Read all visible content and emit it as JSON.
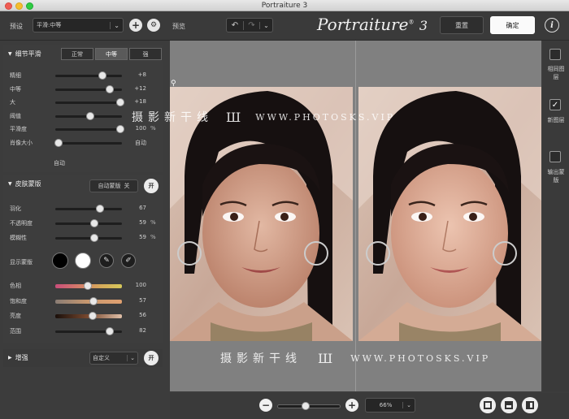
{
  "window": {
    "title": "Portraiture 3"
  },
  "toolbar": {
    "preset_label": "预设",
    "preset_value": "平滑:中等",
    "preview_label": "预览",
    "logo": "Portraiture",
    "logo_version": "3",
    "reset_label": "重置",
    "ok_label": "确定",
    "info_symbol": "i"
  },
  "detail": {
    "header": "细节平滑",
    "modes": [
      "正常",
      "中等",
      "强"
    ],
    "active_mode": "中等",
    "sliders": [
      {
        "label": "精细",
        "value": "+8",
        "unit": "",
        "pos": 0.71
      },
      {
        "label": "中等",
        "value": "+12",
        "unit": "",
        "pos": 0.82
      },
      {
        "label": "大",
        "value": "+18",
        "unit": "",
        "pos": 0.98
      },
      {
        "label": "阈值",
        "value": "",
        "unit": "",
        "pos": 0.52
      },
      {
        "label": "平滑度",
        "value": "100",
        "unit": "%",
        "pos": 0.98
      },
      {
        "label": "肖像大小",
        "value": "自动",
        "unit": "",
        "pos": 0.05
      }
    ],
    "auto_label": "自动"
  },
  "skin": {
    "header": "皮肤蒙版",
    "auto_mask_label": "自动蒙版",
    "auto_mask_state": "关",
    "toggle_label": "开",
    "sliders": [
      {
        "label": "羽化",
        "value": "67",
        "unit": "",
        "pos": 0.67
      },
      {
        "label": "不透明度",
        "value": "59",
        "unit": "%",
        "pos": 0.59
      },
      {
        "label": "模糊性",
        "value": "59",
        "unit": "%",
        "pos": 0.59
      }
    ],
    "show_mask_label": "显示蒙版",
    "color_sliders": [
      {
        "label": "色相",
        "value": "100",
        "pos": 0.49,
        "grad": "linear-gradient(90deg,#c94d7a,#d47a6a,#d6a85a,#d6c85a)"
      },
      {
        "label": "饱和度",
        "value": "57",
        "pos": 0.57,
        "grad": "linear-gradient(90deg,#8a7d75,#c9986e,#e0a070)"
      },
      {
        "label": "亮度",
        "value": "56",
        "pos": 0.56,
        "grad": "linear-gradient(90deg,#1a0f0a,#7a4a30,#e0c0a8)"
      },
      {
        "label": "范围",
        "value": "82",
        "pos": 0.82,
        "grad": ""
      }
    ]
  },
  "enhance": {
    "header": "增强",
    "preset": "自定义",
    "toggle_label": "开"
  },
  "right": {
    "items": [
      {
        "label": "相同图层",
        "checked": false
      },
      {
        "label": "新图层",
        "checked": true
      },
      {
        "label": "输出蒙版",
        "checked": false
      }
    ]
  },
  "watermark": {
    "brand": "摄影新干线",
    "logo": "Ш",
    "url": "WWW.PHOTOSKS.VIP"
  },
  "bottom": {
    "zoom_value": "66%",
    "zoom_level": 0.45,
    "minus": "−",
    "plus": "+"
  },
  "colors": {
    "accent_white": "#ffffff",
    "panel": "#3d3d3d",
    "canvas": "#808080"
  }
}
